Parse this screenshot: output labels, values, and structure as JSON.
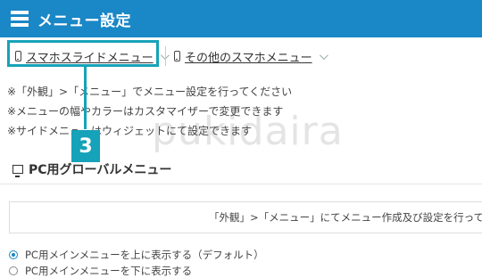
{
  "header": {
    "title": "メニュー設定",
    "icon": "hamburger-icon"
  },
  "tabs": [
    {
      "label": "スマホスライドメニュー",
      "icon": "smartphone-icon"
    },
    {
      "label": "その他のスマホメニュー",
      "icon": "smartphone-icon"
    }
  ],
  "notes": [
    "※「外観」>「メニュー」でメニュー設定を行ってください",
    "※メニューの幅やカラーはカスタマイザーで変更できます",
    "※サイドメニューはウィジェットにて設定できます"
  ],
  "annotation": {
    "step": "3",
    "color": "#16a2b8"
  },
  "watermark": "pukidaira",
  "section": {
    "title": "PC用グローバルメニュー",
    "icon": "monitor-icon"
  },
  "info_text": "「外観」>「メニュー」にてメニュー作成及び設定を行って",
  "options": [
    {
      "label": "PC用メインメニューを上に表示する（デフォルト）",
      "selected": true
    },
    {
      "label": "PC用メインメニューを下に表示する",
      "selected": false
    }
  ],
  "colors": {
    "header_bg": "#1a87c6",
    "accent": "#16a2b8"
  }
}
